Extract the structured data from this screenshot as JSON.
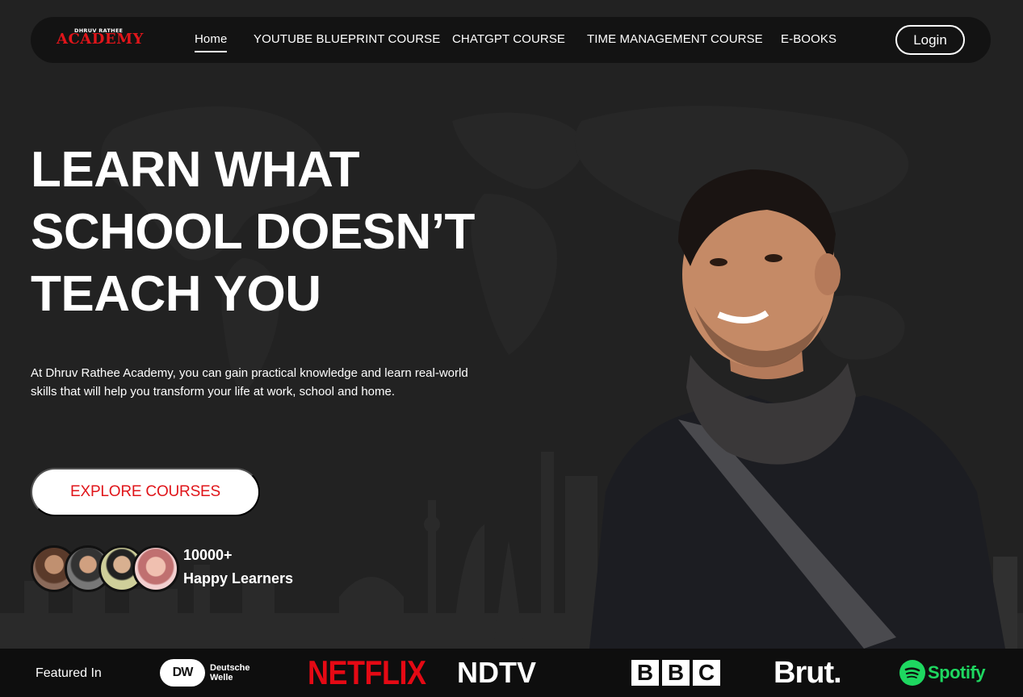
{
  "nav": {
    "logo_top": "DHRUV RATHEE",
    "logo_main": "ACADEMY",
    "links": [
      {
        "label": "Home",
        "active": true
      },
      {
        "label": "YOUTUBE BLUEPRINT COURSE",
        "active": false
      },
      {
        "label": "CHATGPT COURSE",
        "active": false
      },
      {
        "label": "TIME MANAGEMENT COURSE",
        "active": false
      },
      {
        "label": "E-BOOKS",
        "active": false
      }
    ],
    "login_label": "Login"
  },
  "hero": {
    "title_lines": [
      "LEARN WHAT",
      "SCHOOL DOESN’T",
      "TEACH YOU"
    ],
    "description": "At Dhruv Rathee Academy, you can gain practical knowledge and learn real-world skills that will help you transform your life at work, school and home.",
    "cta_label": "EXPLORE COURSES",
    "learners_count": "10000+",
    "learners_label": "Happy Learners"
  },
  "featured": {
    "label": "Featured In",
    "brands": {
      "dw_mark": "DW",
      "dw_name_1": "Deutsche",
      "dw_name_2": "Welle",
      "netflix": "NETFLIX",
      "ndtv": "NDTV",
      "bbc": [
        "B",
        "B",
        "C"
      ],
      "brut": "Brut.",
      "spotify": "Spotify"
    }
  },
  "colors": {
    "accent": "#e0151a",
    "background": "#222222",
    "nav_background": "#131313",
    "spotify": "#1ed760",
    "netflix": "#e50914"
  }
}
